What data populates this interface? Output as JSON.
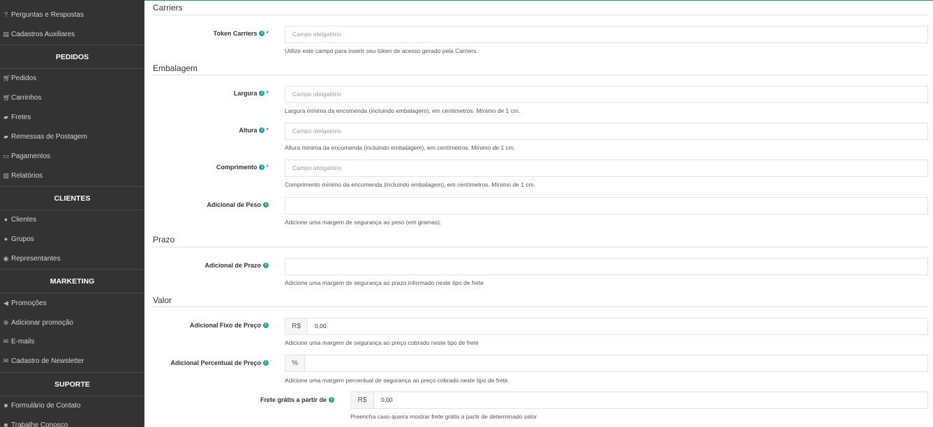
{
  "sidebar": {
    "items_top": [
      {
        "label": "Perguntas e Respostas",
        "icon": "question-circle-icon"
      },
      {
        "label": "Cadastros Auxiliares",
        "icon": "file-icon"
      }
    ],
    "sections": [
      {
        "heading": "PEDIDOS",
        "items": [
          {
            "label": "Pedidos",
            "icon": "cart-icon"
          },
          {
            "label": "Carrinhos",
            "icon": "cart-icon"
          },
          {
            "label": "Fretes",
            "icon": "truck-icon"
          },
          {
            "label": "Remessas de Postagem",
            "icon": "truck-icon"
          },
          {
            "label": "Pagamentos",
            "icon": "credit-card-icon"
          },
          {
            "label": "Relatórios",
            "icon": "bar-chart-icon"
          }
        ]
      },
      {
        "heading": "CLIENTES",
        "items": [
          {
            "label": "Clientes",
            "icon": "user-icon"
          },
          {
            "label": "Grupos",
            "icon": "users-icon"
          },
          {
            "label": "Representantes",
            "icon": "user-circle-icon"
          }
        ]
      },
      {
        "heading": "MARKETING",
        "items": [
          {
            "label": "Promoções",
            "icon": "bullhorn-icon"
          },
          {
            "label": "Adicionar promoção",
            "icon": "plus-circle-icon"
          },
          {
            "label": "E-mails",
            "icon": "envelope-icon"
          },
          {
            "label": "Cadastro de Newsletter",
            "icon": "envelope-icon"
          }
        ]
      },
      {
        "heading": "SUPORTE",
        "items": [
          {
            "label": "Formulário de Contato",
            "icon": "comment-icon"
          },
          {
            "label": "Trabalhe Conosco",
            "icon": "comment-icon"
          }
        ]
      }
    ]
  },
  "form": {
    "sections": {
      "carriers": "Carriers",
      "embalagem": "Embalagem",
      "prazo": "Prazo",
      "valor": "Valor"
    },
    "token": {
      "label": "Token Carriers",
      "placeholder": "Campo obrigatório",
      "help": "Utilize este campo para inserir seu token de acesso gerado pela Carriers."
    },
    "largura": {
      "label": "Largura",
      "placeholder": "Campo obrigatório",
      "help": "Largura mínima da encomenda (incluindo embalagem), em centímetros. Mínimo de 1 cm."
    },
    "altura": {
      "label": "Altura",
      "placeholder": "Campo obrigatório",
      "help": "Altura mínima da encomenda (incluindo embalagem), em centímetros. Mínimo de 1 cm."
    },
    "comprimento": {
      "label": "Comprimento",
      "placeholder": "Campo obrigatório",
      "help": "Comprimento mínimo da encomenda (incluindo embalagem), em centímetros. Mínimo de 1 cm."
    },
    "peso": {
      "label": "Adicional de Peso",
      "value": "",
      "help": "Adicione uma margem de segurança ao peso (em gramas)."
    },
    "prazo": {
      "label": "Adicional de Prazo",
      "value": "",
      "help": "Adicione uma margem de segurança ao prazo informado neste tipo de frete"
    },
    "preco_fixo": {
      "label": "Adicional Fixo de Preço",
      "addon": "R$",
      "value": "0,00",
      "help": "Adicione uma margem de segurança ao preço cobrado neste tipo de frete"
    },
    "preco_percentual": {
      "label": "Adicional Percentual de Preço",
      "addon": "%",
      "value": "",
      "help": "Adicione uma margem percentual de segurança ao preço cobrado neste tipo de frete."
    },
    "frete_gratis": {
      "label": "Frete grátis a partir de",
      "addon": "R$",
      "value": "0,00",
      "help": "Preencha caso queira mostrar frete grátis a partir de determinado valor"
    },
    "required_mark": "*",
    "info_glyph": "i"
  },
  "colors": {
    "sidebar_bg": "#333333",
    "accent": "#26a69a"
  }
}
